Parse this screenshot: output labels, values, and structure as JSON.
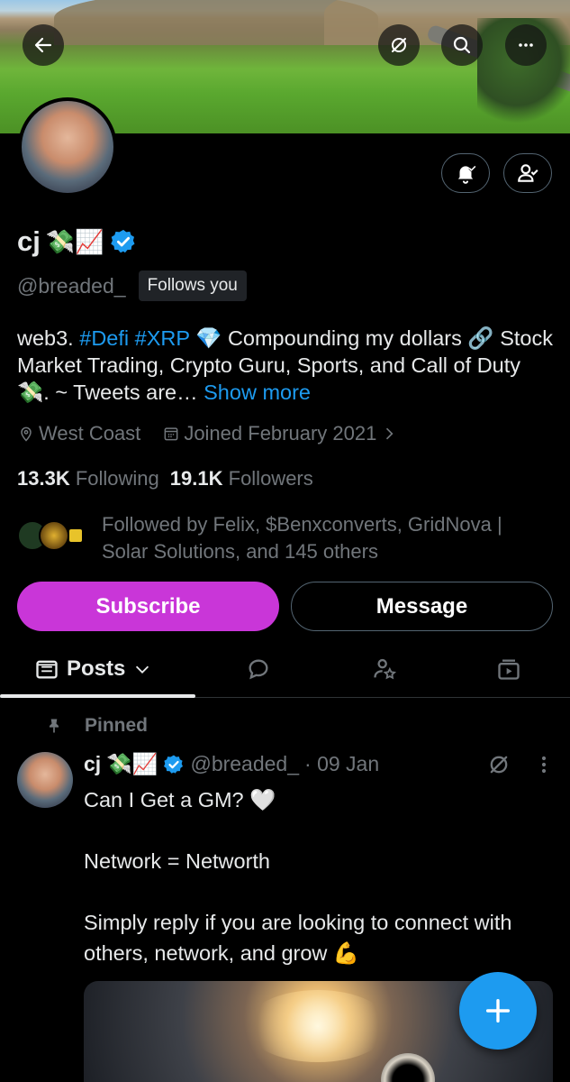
{
  "colors": {
    "accent": "#1d9bf0",
    "subscribe": "#c936d8",
    "background": "#000000",
    "muted": "#71767b"
  },
  "profile": {
    "name": "cj",
    "name_emoji": "💸📈",
    "handle": "@breaded_",
    "follows_you": "Follows you",
    "bio": {
      "part1": "web3. ",
      "tag1": "#Defi",
      "space": " ",
      "tag2": "#XRP",
      "part2": " 💎 Compounding my dollars 🔗 Stock Market Trading, Crypto Guru, Sports, and Call of Duty 💸. ~ Tweets are… ",
      "show_more": "Show more"
    },
    "location": "West Coast",
    "joined": "Joined February 2021",
    "following_count": "13.3K",
    "following_label": "Following",
    "followers_count": "19.1K",
    "followers_label": "Followers",
    "followed_by": "Followed by Felix, $Benxconverts, GridNova | Solar Solutions, and 145 others"
  },
  "buttons": {
    "subscribe": "Subscribe",
    "message": "Message"
  },
  "tabs": {
    "posts": "Posts"
  },
  "post": {
    "pinned": "Pinned",
    "name": "cj",
    "name_emoji": "💸📈",
    "handle": "@breaded_",
    "date": "· 09 Jan",
    "text": "Can I Get a GM? 🤍\n\nNetwork = Networth\n\nSimply reply if you are looking to connect with others, network, and grow 💪"
  },
  "icons": [
    "back-arrow-icon",
    "grok-icon",
    "search-icon",
    "more-icon",
    "notification-bell-icon",
    "following-user-icon",
    "verified-badge-icon",
    "location-icon",
    "calendar-icon",
    "chevron-right-icon",
    "posts-icon",
    "chevron-down-icon",
    "replies-icon",
    "highlights-icon",
    "media-icon",
    "pin-icon",
    "compose-plus-icon"
  ]
}
